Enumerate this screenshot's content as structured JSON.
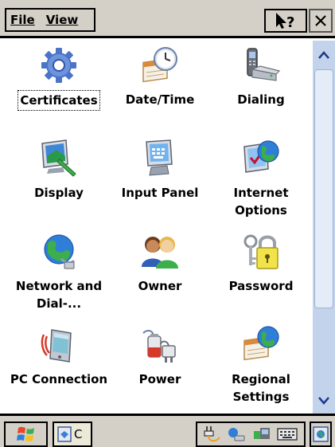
{
  "menubar": {
    "file_label": "File",
    "view_label": "View"
  },
  "items": [
    {
      "label": "Certificates",
      "icon": "gear-icon"
    },
    {
      "label": "Date/Time",
      "icon": "clock-calendar-icon"
    },
    {
      "label": "Dialing",
      "icon": "phone-modem-icon"
    },
    {
      "label": "Display",
      "icon": "monitor-brush-icon"
    },
    {
      "label": "Input Panel",
      "icon": "monitor-keyboard-icon"
    },
    {
      "label": "Internet Options",
      "icon": "globe-monitor-icon"
    },
    {
      "label": "Network and Dial-...",
      "icon": "globe-network-icon"
    },
    {
      "label": "Owner",
      "icon": "users-icon"
    },
    {
      "label": "Password",
      "icon": "padlock-keys-icon"
    },
    {
      "label": "PC Connection",
      "icon": "pda-connection-icon"
    },
    {
      "label": "Power",
      "icon": "battery-plug-icon"
    },
    {
      "label": "Regional Settings",
      "icon": "globe-calendar-icon"
    }
  ],
  "selected_item": "Certificates",
  "taskbar": {
    "task_label": "C"
  },
  "colors": {
    "chrome": "#d4d0c8",
    "scrollbar_track": "#c4d3ec",
    "content_bg": "#ffffff"
  }
}
